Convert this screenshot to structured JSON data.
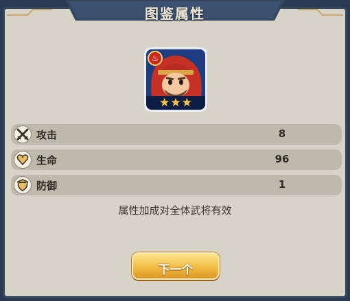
{
  "dialog": {
    "title": "图鉴属性",
    "note": "属性加成对全体武将有效",
    "next_label": "下一个"
  },
  "hero": {
    "stars": [
      "★",
      "★",
      "★"
    ],
    "element_icon": "fire-icon"
  },
  "stats": [
    {
      "icon": "crossed-swords-icon",
      "label": "攻击",
      "value": "8"
    },
    {
      "icon": "heart-icon",
      "label": "生命",
      "value": "96"
    },
    {
      "icon": "shield-icon",
      "label": "防御",
      "value": "1"
    }
  ],
  "colors": {
    "panel_bg": "#d8d3c8",
    "frame": "#35475f",
    "row_bg": "#bfb9ad",
    "button_gold": "#f1b93f",
    "star_gold": "#f5c64b"
  }
}
